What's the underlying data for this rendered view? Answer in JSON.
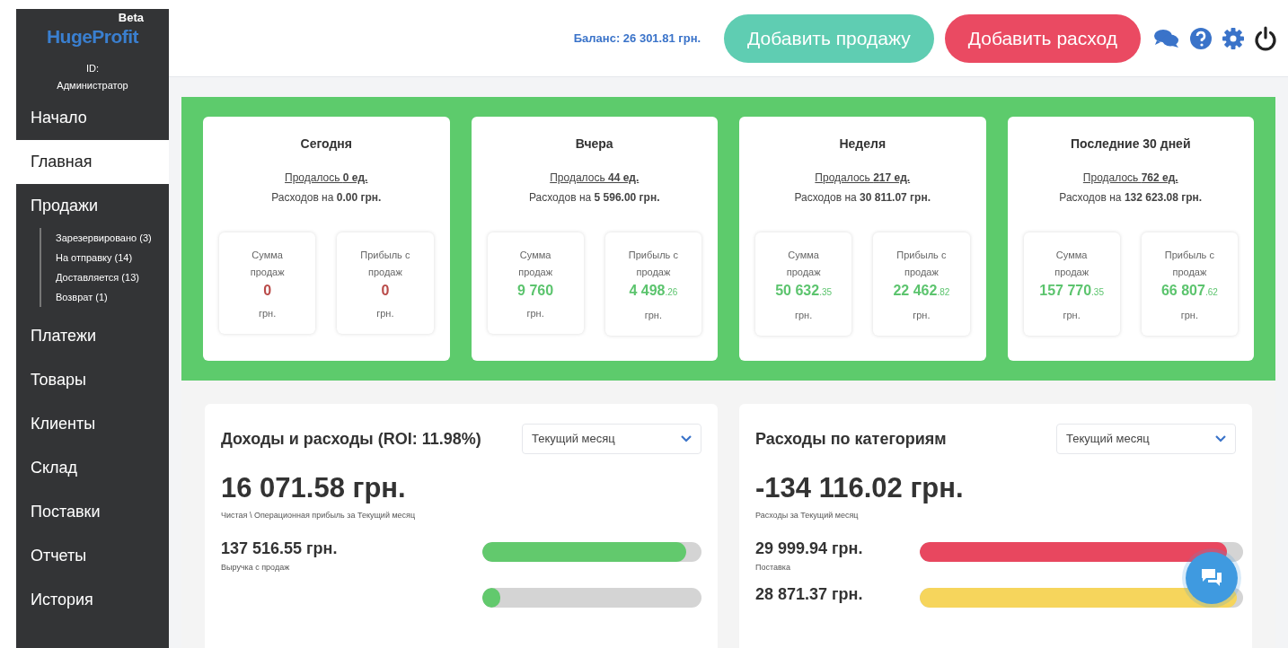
{
  "sidebar": {
    "logo": "HugeProfit",
    "beta": "Beta",
    "id_label": "ID:",
    "user": "Администратор",
    "items": [
      {
        "label": "Начало",
        "selected": false
      },
      {
        "label": "Главная",
        "selected": true
      },
      {
        "label": "Продажи",
        "selected": false,
        "children": [
          {
            "label": "Зарезервировано (3)"
          },
          {
            "label": "На отправку (14)"
          },
          {
            "label": "Доставляется (13)"
          },
          {
            "label": "Возврат (1)"
          }
        ]
      },
      {
        "label": "Платежи",
        "selected": false
      },
      {
        "label": "Товары",
        "selected": false
      },
      {
        "label": "Клиенты",
        "selected": false
      },
      {
        "label": "Склад",
        "selected": false
      },
      {
        "label": "Поставки",
        "selected": false
      },
      {
        "label": "Отчеты",
        "selected": false
      },
      {
        "label": "История",
        "selected": false
      }
    ]
  },
  "header": {
    "balance": "Баланс: 26 301.81 грн.",
    "buttons": [
      {
        "label": "Добавить продажу",
        "kind": "sale"
      },
      {
        "label": "Добавить расход",
        "kind": "expense"
      }
    ]
  },
  "summary": [
    {
      "title": "Сегодня",
      "sold": "Продалось **0 ед.**",
      "expenses": "Расходов на **0.00 грн.**",
      "stats": [
        {
          "label": "Сумма продаж",
          "value": "0",
          "unit": "грн.",
          "color": "#b94a48"
        },
        {
          "label": "Прибыль с продаж",
          "value": "0",
          "unit": "грн.",
          "color": "#b94a48"
        }
      ]
    },
    {
      "title": "Вчера",
      "sold": "Продалось **44 ед.**",
      "expenses": "Расходов на **5 596.00 грн.**",
      "stats": [
        {
          "label": "Сумма продаж",
          "value": "9 760",
          "unit": "грн.",
          "color": "#5cc46e"
        },
        {
          "label": "Прибыль с продаж",
          "value": "4 498",
          "cents": ".26",
          "unit": "грн.",
          "color": "#5cc46e"
        }
      ]
    },
    {
      "title": "Неделя",
      "sold": "Продалось **217 ед.**",
      "expenses": "Расходов на **30 811.07 грн.**",
      "stats": [
        {
          "label": "Сумма продаж",
          "value": "50 632",
          "cents": ".35",
          "unit": "грн.",
          "color": "#5cc46e"
        },
        {
          "label": "Прибыль с продаж",
          "value": "22 462",
          "cents": ".82",
          "unit": "грн.",
          "color": "#5cc46e"
        }
      ]
    },
    {
      "title": "Последние 30 дней",
      "sold": "Продалось **762 ед.**",
      "expenses": "Расходов на **132 623.08 грн.**",
      "stats": [
        {
          "label": "Сумма продаж",
          "value": "157 770",
          "cents": ".35",
          "unit": "грн.",
          "color": "#5cc46e"
        },
        {
          "label": "Прибыль с продаж",
          "value": "66 807",
          "cents": ".62",
          "unit": "грн.",
          "color": "#5cc46e"
        }
      ]
    }
  ],
  "panels": [
    {
      "title": "Доходы и расходы (ROI: 11.98%)",
      "period": "Текущий месяц",
      "total": "16 071.58 грн.",
      "caption": "Чистая \\ Операционная прибыль за Текущий месяц",
      "bars": [
        {
          "amount": "137 516.55 грн.",
          "label": "Выручка с продаж",
          "level": 0.93,
          "color": "#62c96d"
        },
        {
          "level": 0.08,
          "color": "#62c96d"
        }
      ]
    },
    {
      "title": "Расходы по категориям",
      "period": "Текущий месяц",
      "total": "-134 116.02 грн.",
      "caption": "Расходы за Текущий месяц",
      "bars": [
        {
          "amount": "29 999.94 грн.",
          "label": "Поставка",
          "level": 0.95,
          "color": "#e8475f"
        },
        {
          "amount": "28 871.37 грн.",
          "level": 0.98,
          "color": "#f6d55c"
        }
      ]
    }
  ]
}
